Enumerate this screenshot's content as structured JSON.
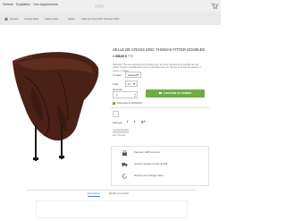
{
  "header": {
    "logo_text": "Sellerie · Equitation · Vos équipements",
    "cart_icon": "cart-icon"
  },
  "breadcrumb": {
    "home_icon": "home-icon",
    "items": [
      "Accueil",
      "Cheval-Selle",
      "Selles-Selle",
      "Selles",
      "Selle de cross Eric Thomas Fitter"
    ]
  },
  "product": {
    "title": "SELLE DE CROSS ERIC THOMAS FITTER DOUBLEE",
    "price": "1 935,00 €",
    "price_suffix": "TTC",
    "description": "Selle Eric Thomas spécialement étudiée pour le Cross. Entièrement doublée de cuir grainé souple et antidérapant pour confortablement sur l'arrière et le bas de quartier. 2 coloris, 3 tailles.",
    "options": [
      {
        "label": "Couleur",
        "value": "Havane"
      },
      {
        "label": "Taille",
        "value": "17"
      }
    ],
    "quantity_label": "Quantité",
    "quantity": "1",
    "add_to_cart": "AJOUTER AU PANIER",
    "availability": "Disponible le 15/03/2017",
    "share_label": "Partager",
    "share_icons": [
      "f",
      "t",
      "g+"
    ],
    "brand": "Eric Thomas"
  },
  "reassurance": [
    {
      "icon": "lock-icon",
      "text": "Paiement 100% sécurisé"
    },
    {
      "icon": "truck-icon",
      "text": "Livraison gratuite à partir de 80€"
    },
    {
      "icon": "return-icon",
      "text": "30 jours pour changer d'avis"
    }
  ],
  "tabs": [
    {
      "label": "Description",
      "active": true
    },
    {
      "label": "Détails du produit",
      "active": false
    }
  ],
  "colors": {
    "accent_green": "#6dae43",
    "saddle_brown": "#4a2116",
    "tab_blue": "#3a7bd5"
  }
}
